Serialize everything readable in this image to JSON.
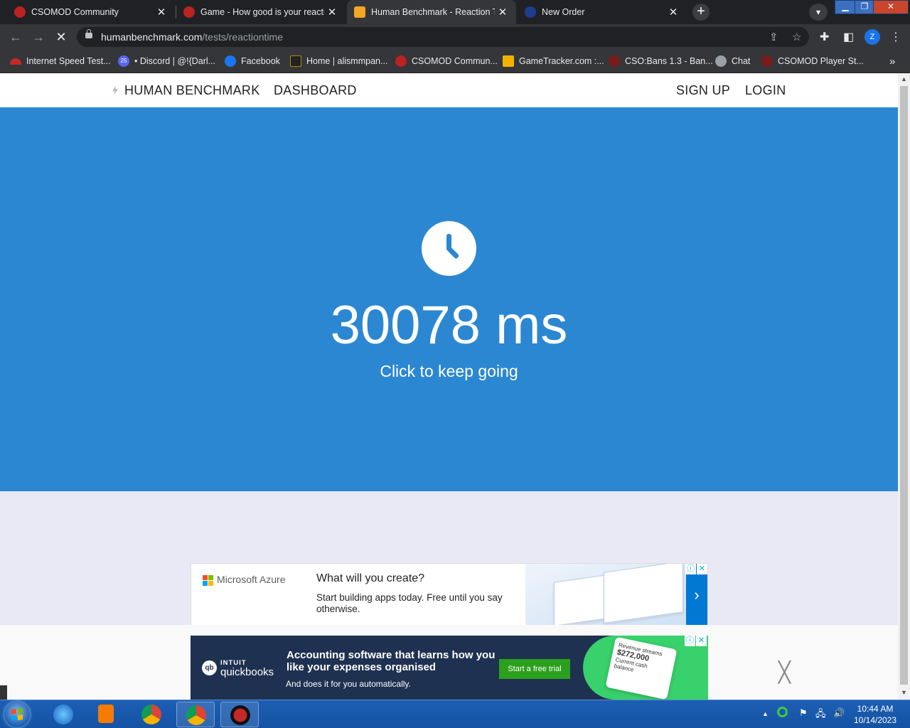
{
  "browser": {
    "tabs": [
      {
        "title": "CSOMOD Community",
        "active": false
      },
      {
        "title": "Game - How good is your reaction",
        "active": false
      },
      {
        "title": "Human Benchmark - Reaction Time",
        "active": true
      },
      {
        "title": "New Order",
        "active": false
      }
    ],
    "url_host": "humanbenchmark.com",
    "url_path": "/tests/reactiontime",
    "profile_initial": "Z",
    "bookmarks": [
      "Internet Speed Test...",
      "• Discord | @!{Darl...",
      "Facebook",
      "Home | alismmpan...",
      "CSOMOD Commun...",
      "GameTracker.com :...",
      "CSO:Bans 1.3 - Ban...",
      "Chat",
      "CSOMOD Player St..."
    ],
    "discord_badge": "25",
    "overflow_glyph": "»"
  },
  "site": {
    "brand": "HUMAN BENCHMARK",
    "dashboard": "DASHBOARD",
    "signup": "SIGN UP",
    "login": "LOGIN",
    "result": "30078 ms",
    "subtitle": "Click to keep going",
    "hero_color": "#2b87d1"
  },
  "ads": {
    "azure": {
      "brand": "Microsoft Azure",
      "headline": "What will you create?",
      "body": "Start building apps today. Free until you say otherwise.",
      "arrow": "›"
    },
    "quickbooks": {
      "intuit": "INTUIT",
      "name": "quickbooks",
      "headline": "Accounting software that learns how you like your expenses organised",
      "body": "And does it for you automatically.",
      "cta": "Start a free trial",
      "card_title": "Revenue streams",
      "card_amount": "$272,000",
      "card_caption": "Current cash balance"
    },
    "close": "╳"
  },
  "taskbar": {
    "time": "10:44 AM",
    "date": "10/14/2023"
  }
}
